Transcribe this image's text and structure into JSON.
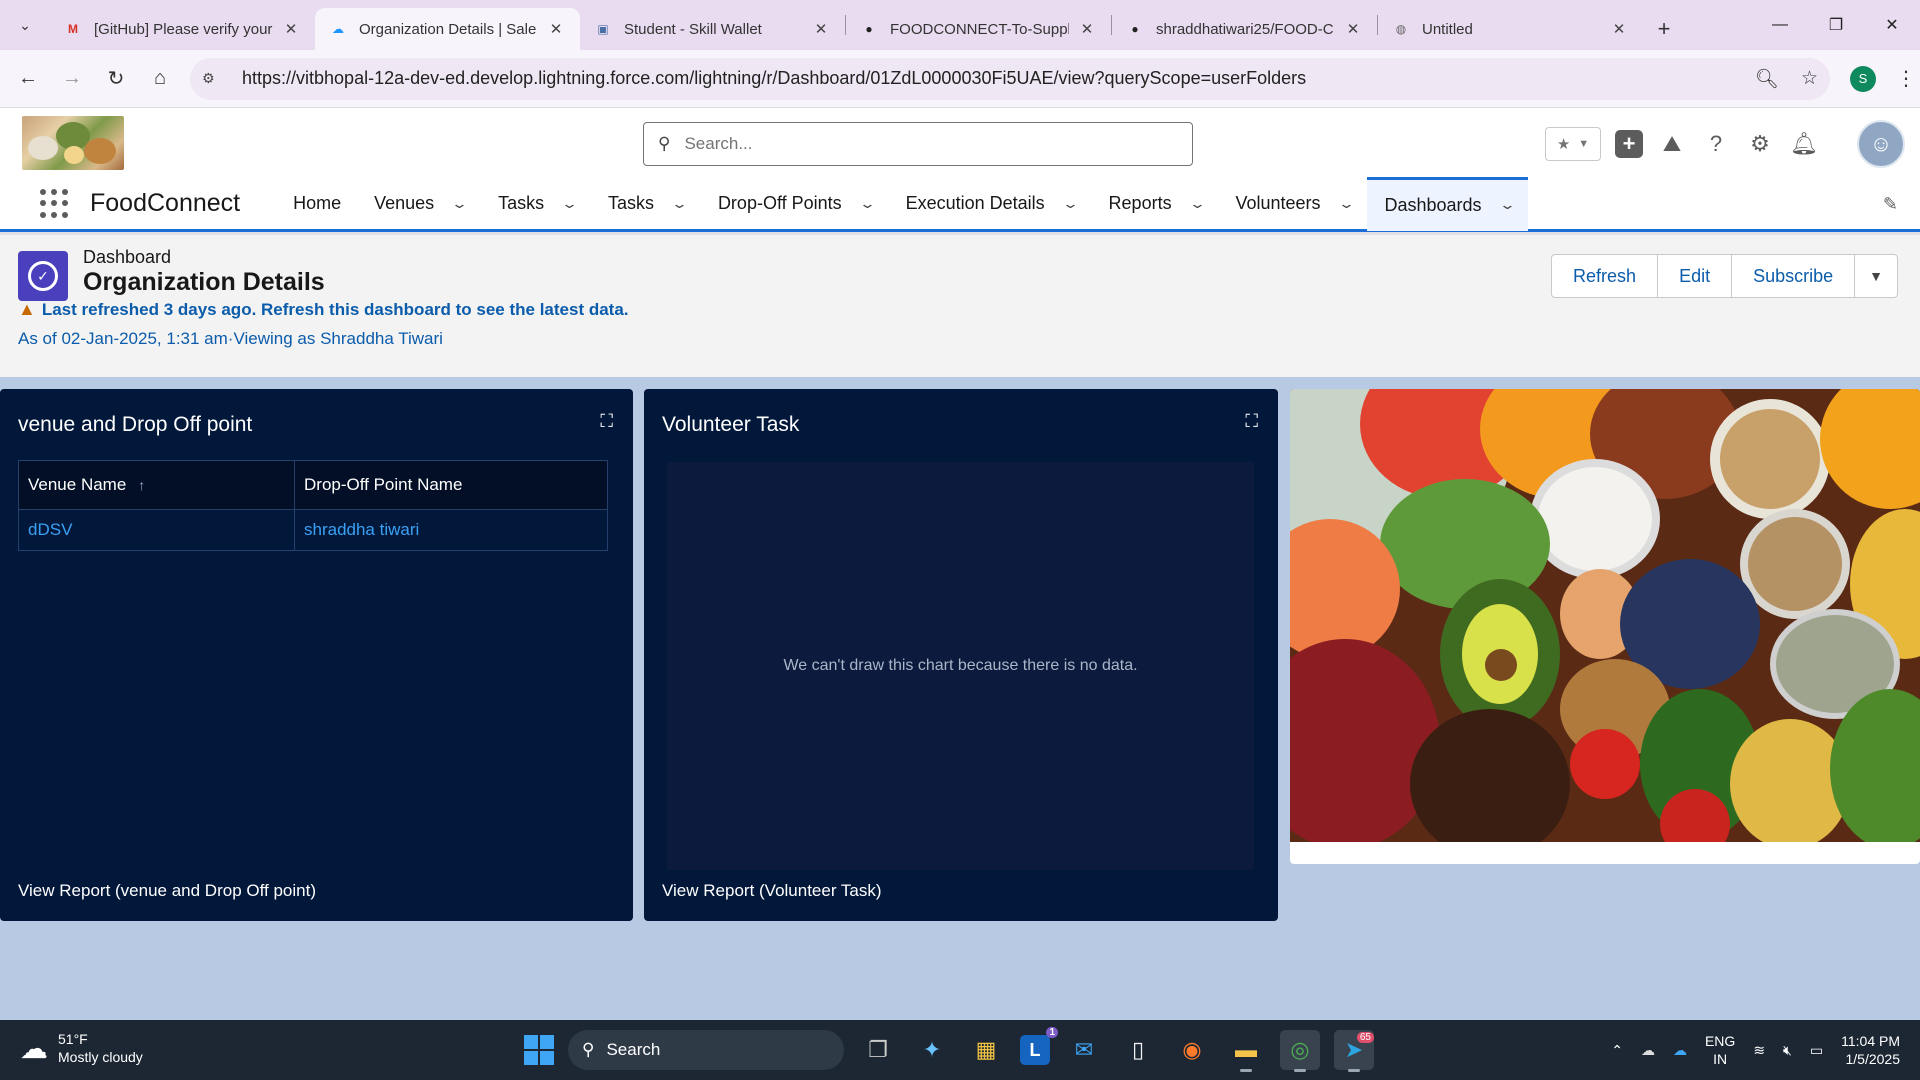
{
  "browser": {
    "tabs": [
      {
        "title": "[GitHub] Please verify your",
        "icon": "gmail-icon",
        "active": false
      },
      {
        "title": "Organization Details | Sale",
        "icon": "salesforce-cloud-icon",
        "active": true
      },
      {
        "title": "Student - Skill Wallet",
        "icon": "skill-wallet-icon",
        "active": false
      },
      {
        "title": "FOODCONNECT-To-Supply",
        "icon": "github-icon",
        "active": false
      },
      {
        "title": "shraddhatiwari25/FOOD-C",
        "icon": "github-icon",
        "active": false
      },
      {
        "title": "Untitled",
        "icon": "globe-icon",
        "active": false
      }
    ],
    "url": "https://vitbhopal-12a-dev-ed.develop.lightning.force.com/lightning/r/Dashboard/01ZdL0000030Fi5UAE/view?queryScope=userFolders",
    "profile_initial": "S"
  },
  "sf": {
    "search_placeholder": "Search...",
    "app_name": "FoodConnect",
    "nav": [
      {
        "label": "Home",
        "chevron": false,
        "active": false
      },
      {
        "label": "Venues",
        "chevron": true,
        "active": false
      },
      {
        "label": "Tasks",
        "chevron": true,
        "active": false
      },
      {
        "label": "Tasks",
        "chevron": true,
        "active": false
      },
      {
        "label": "Drop-Off Points",
        "chevron": true,
        "active": false
      },
      {
        "label": "Execution Details",
        "chevron": true,
        "active": false
      },
      {
        "label": "Reports",
        "chevron": true,
        "active": false
      },
      {
        "label": "Volunteers",
        "chevron": true,
        "active": false
      },
      {
        "label": "Dashboards",
        "chevron": true,
        "active": true
      }
    ]
  },
  "dashboard": {
    "type_label": "Dashboard",
    "title": "Organization Details",
    "warning": "Last refreshed 3 days ago. Refresh this dashboard to see the latest data.",
    "as_of": "As of 02-Jan-2025, 1:31 am·Viewing as Shraddha Tiwari",
    "actions": {
      "refresh": "Refresh",
      "edit": "Edit",
      "subscribe": "Subscribe"
    },
    "widgets": {
      "venue_table": {
        "title": "venue and Drop Off point",
        "columns": [
          "Venue Name",
          "Drop-Off Point Name"
        ],
        "rows": [
          [
            "dDSV",
            "shraddha tiwari"
          ]
        ],
        "footer": "View Report (venue and Drop Off point)"
      },
      "volunteer_chart": {
        "title": "Volunteer Task",
        "empty_message": "We can't draw this chart because there is no data.",
        "footer": "View Report (Volunteer Task)"
      }
    }
  },
  "taskbar": {
    "weather_temp": "51°F",
    "weather_desc": "Mostly cloudy",
    "search_label": "Search",
    "mail_badge": "1",
    "telegram_badge": "65",
    "lang_line1": "ENG",
    "lang_line2": "IN",
    "time": "11:04 PM",
    "date": "1/5/2025"
  }
}
